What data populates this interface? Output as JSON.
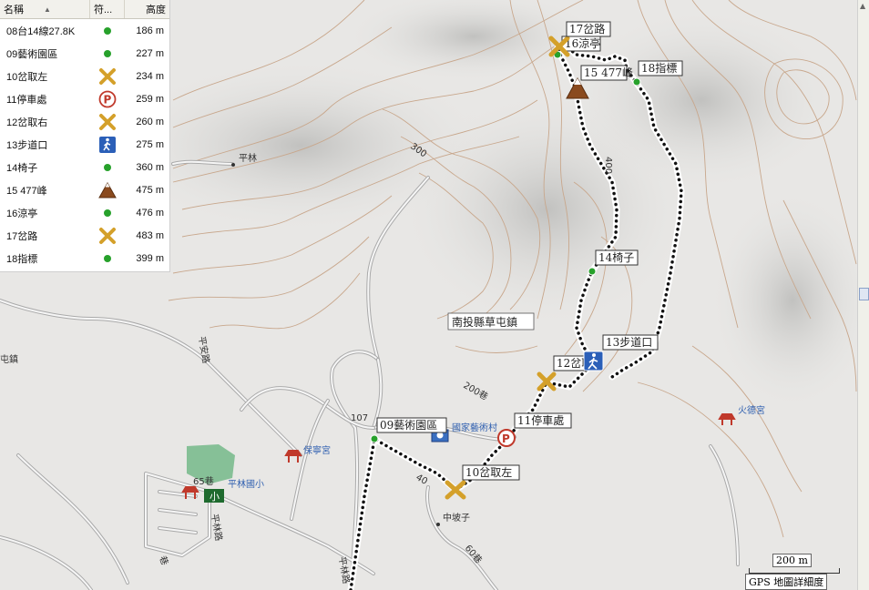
{
  "table": {
    "headers": {
      "name": "名稱",
      "symbol": "符...",
      "elevation": "高度"
    },
    "rows": [
      {
        "name": "08台14線27.8K",
        "icon": "green-dot",
        "elevation": "186 m"
      },
      {
        "name": "09藝術園區",
        "icon": "green-dot",
        "elevation": "227 m"
      },
      {
        "name": "10岔取左",
        "icon": "crossroad-x-icon",
        "elevation": "234 m"
      },
      {
        "name": "11停車處",
        "icon": "parking-icon",
        "elevation": "259 m"
      },
      {
        "name": "12岔取右",
        "icon": "crossroad-x-icon",
        "elevation": "260 m"
      },
      {
        "name": "13步道口",
        "icon": "hiker-icon",
        "elevation": "275 m"
      },
      {
        "name": "14椅子",
        "icon": "green-dot",
        "elevation": "360 m"
      },
      {
        "name": "15 477峰",
        "icon": "summit-icon",
        "elevation": "475 m"
      },
      {
        "name": "16涼亭",
        "icon": "green-dot",
        "elevation": "476 m"
      },
      {
        "name": "17岔路",
        "icon": "crossroad-x-icon",
        "elevation": "483 m"
      },
      {
        "name": "18指標",
        "icon": "green-dot",
        "elevation": "399 m"
      }
    ]
  },
  "map": {
    "waypoints": {
      "wp17": "17岔路",
      "wp16": "16涼亭",
      "wp15": "15 477峰",
      "wp18": "18指標",
      "wp14": "14椅子",
      "wp13": "13步道口",
      "wp12": "12岔取右",
      "wp11": "11停車處",
      "wp10": "10岔取左",
      "wp09": "09藝術園區"
    },
    "labels": {
      "township": "南投縣草屯鎮",
      "ping_lin": "平林",
      "art_village": "國家藝術村",
      "fire_temple": "火德宮",
      "temple_mid": "保寧宮",
      "school": "平林國小",
      "zhong_di": "中坡子",
      "road65": "65巷",
      "road107": "107",
      "road200": "200巷",
      "road40": "40",
      "road60": "60巷",
      "road_left": "平安路",
      "road_left2": "平林路",
      "road_lane": "巷",
      "road_bottom": "平林路",
      "town_left": "屯鎮",
      "c300": "300",
      "c400": "400"
    },
    "scale": {
      "distance": "200 m",
      "caption": "GPS 地圖詳細度"
    },
    "colors": {
      "track": "#111111",
      "waypoint": "#27a12b",
      "terrain": "#e7e6e4",
      "park": "#74b88a",
      "temple": "#c0392b"
    }
  }
}
